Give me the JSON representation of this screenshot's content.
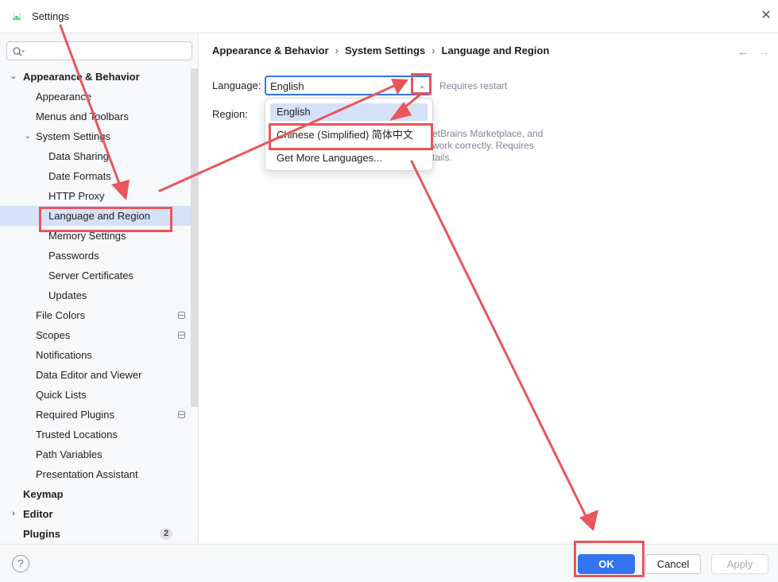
{
  "window": {
    "title": "Settings"
  },
  "search": {
    "placeholder": ""
  },
  "sidebar": {
    "items": [
      {
        "label": "Appearance & Behavior"
      },
      {
        "label": "Appearance"
      },
      {
        "label": "Menus and Toolbars"
      },
      {
        "label": "System Settings"
      },
      {
        "label": "Data Sharing"
      },
      {
        "label": "Date Formats"
      },
      {
        "label": "HTTP Proxy"
      },
      {
        "label": "Language and Region"
      },
      {
        "label": "Memory Settings"
      },
      {
        "label": "Passwords"
      },
      {
        "label": "Server Certificates"
      },
      {
        "label": "Updates"
      },
      {
        "label": "File Colors"
      },
      {
        "label": "Scopes"
      },
      {
        "label": "Notifications"
      },
      {
        "label": "Data Editor and Viewer"
      },
      {
        "label": "Quick Lists"
      },
      {
        "label": "Required Plugins"
      },
      {
        "label": "Trusted Locations"
      },
      {
        "label": "Path Variables"
      },
      {
        "label": "Presentation Assistant"
      },
      {
        "label": "Keymap"
      },
      {
        "label": "Editor"
      },
      {
        "label": "Plugins",
        "badge": "2"
      }
    ]
  },
  "breadcrumb": [
    "Appearance & Behavior",
    "System Settings",
    "Language and Region"
  ],
  "form": {
    "language_label": "Language:",
    "language_value": "English",
    "requires_restart": "Requires restart",
    "region_label": "Region:",
    "note_lines": [
      "etBrains Marketplace, and",
      "work correctly. Requires",
      "tails."
    ]
  },
  "dropdown": {
    "options": [
      "English",
      "Chinese (Simplified) 简体中文",
      "Get More Languages..."
    ]
  },
  "buttons": {
    "ok": "OK",
    "cancel": "Cancel",
    "apply": "Apply",
    "help": "?"
  },
  "colors": {
    "accent": "#3574f0",
    "selection": "#d5e1f7",
    "annotation": "#e8565c"
  }
}
